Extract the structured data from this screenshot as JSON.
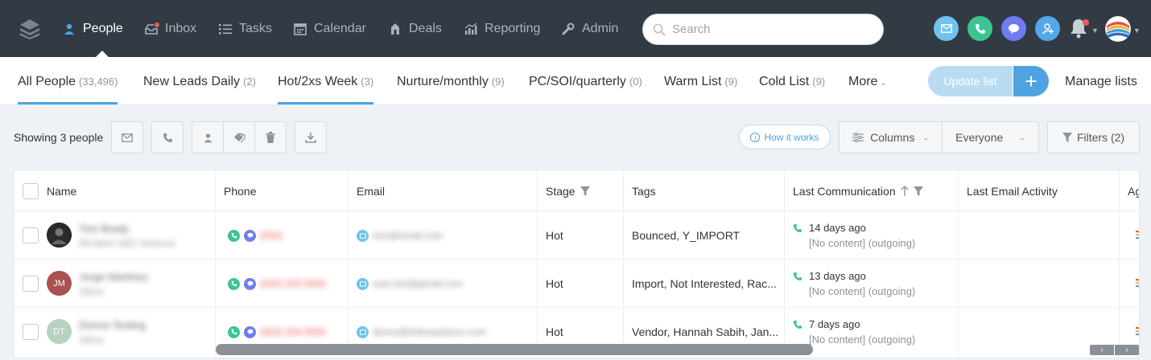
{
  "nav": {
    "items": [
      {
        "label": "People",
        "icon": "person-icon",
        "active": true
      },
      {
        "label": "Inbox",
        "icon": "inbox-icon"
      },
      {
        "label": "Tasks",
        "icon": "tasks-list-icon"
      },
      {
        "label": "Calendar",
        "icon": "calendar-icon"
      },
      {
        "label": "Deals",
        "icon": "deals-icon"
      },
      {
        "label": "Reporting",
        "icon": "reporting-chart-icon"
      },
      {
        "label": "Admin",
        "icon": "wrench-icon"
      }
    ],
    "search_placeholder": "Search",
    "quick_actions": [
      {
        "icon": "email-icon",
        "color": "#6fc3ee"
      },
      {
        "icon": "phone-icon",
        "color": "#3cc591"
      },
      {
        "icon": "chat-bubble-icon",
        "color": "#6f7cf0"
      },
      {
        "icon": "add-person-icon",
        "color": "#52a8e8"
      }
    ]
  },
  "lists": {
    "tabs": [
      {
        "label": "All People",
        "count": "(33,496)",
        "active": true
      },
      {
        "label": "New Leads Daily",
        "count": "(2)"
      },
      {
        "label": "Hot/2xs Week",
        "count": "(3)",
        "active": true
      },
      {
        "label": "Nurture/monthly",
        "count": "(9)"
      },
      {
        "label": "PC/SOI/quarterly",
        "count": "(0)"
      },
      {
        "label": "Warm List",
        "count": "(9)"
      },
      {
        "label": "Cold List",
        "count": "(9)"
      }
    ],
    "more_label": "More",
    "update_label": "Update list",
    "plus_label": "+",
    "manage_label": "Manage lists"
  },
  "toolbar": {
    "showing": "Showing 3 people",
    "how_it_works": "How it works",
    "how_icon": "i",
    "columns": "Columns",
    "everyone": "Everyone",
    "filters": "Filters (2)"
  },
  "table": {
    "headers": [
      "Name",
      "Phone",
      "Email",
      "Stage",
      "Tags",
      "Last Communication",
      "Last Email Activity",
      "Ag"
    ],
    "rows": [
      {
        "name": "Tom Brady",
        "name_sub": "RE/MAX ABC Referral",
        "avatar_initials": "",
        "avatar_color": "#2b2b2b",
        "phone": "(555)",
        "email": "tom@email.com",
        "stage": "Hot",
        "tags": "Bounced, Y_IMPORT",
        "last_comm": "14 days ago",
        "last_comm_detail": "[No content] (outgoing)"
      },
      {
        "name": "Jorge Martinez",
        "name_sub": "Zillow",
        "avatar_initials": "JM",
        "avatar_color": "#a8514f",
        "phone": "(555) 555-5555",
        "email": "user.test@gmail.com",
        "stage": "Hot",
        "tags": "Import, Not Interested, Rac...",
        "last_comm": "13 days ago",
        "last_comm_detail": "[No content] (outgoing)"
      },
      {
        "name": "Donna Testing",
        "name_sub": "Zillow",
        "avatar_initials": "DT",
        "avatar_color": "#b5d3c0",
        "phone": "(803) 555-5555",
        "email": "donna@followupboss.com",
        "stage": "Hot",
        "tags": "Vendor, Hannah Sabih, Jan...",
        "last_comm": "7 days ago",
        "last_comm_detail": "[No content] (outgoing)"
      }
    ]
  },
  "scroll": {
    "left_arrow": "‹",
    "right_arrow": "›"
  }
}
